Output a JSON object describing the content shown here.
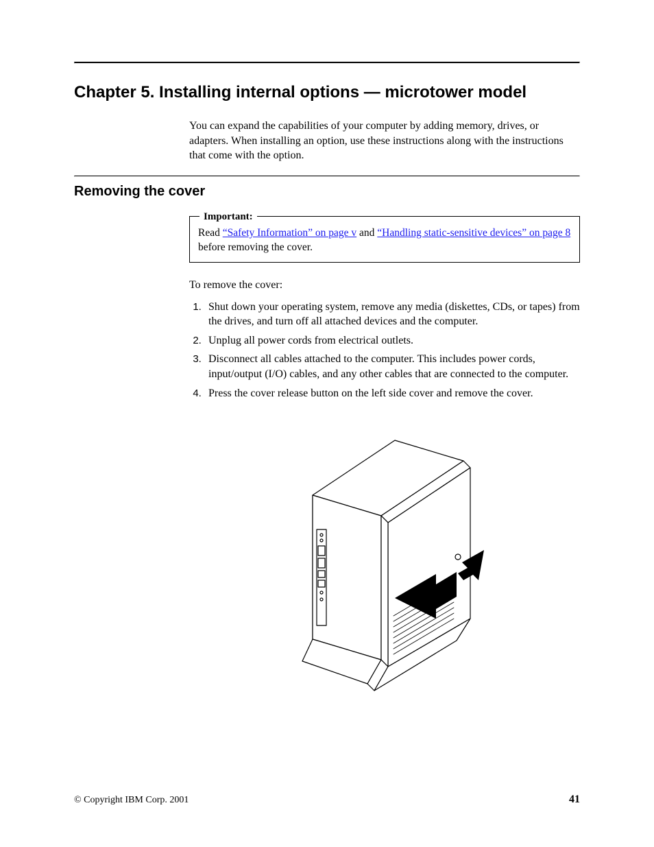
{
  "chapter": {
    "title": "Chapter 5. Installing internal options — microtower model",
    "intro": "You can expand the capabilities of your computer by adding memory, drives, or adapters. When installing an option, use these instructions along with the instructions that come with the option."
  },
  "section": {
    "title": "Removing the cover",
    "note": {
      "label": "Important:",
      "pre": "Read ",
      "link1": "“Safety Information” on page v",
      "mid": " and ",
      "link2": "“Handling static-sensitive devices” on page 8",
      "post": " before removing the cover."
    },
    "lead": "To remove the cover:",
    "steps": [
      "Shut down your operating system, remove any media (diskettes, CDs, or tapes) from the drives, and turn off all attached devices and the computer.",
      "Unplug all power cords from electrical outlets.",
      "Disconnect all cables attached to the computer. This includes power cords, input/output (I/O) cables, and any other cables that are connected to the computer.",
      "Press the cover release button on the left side cover and remove the cover."
    ]
  },
  "footer": {
    "copyright": "© Copyright IBM Corp. 2001",
    "page": "41"
  }
}
